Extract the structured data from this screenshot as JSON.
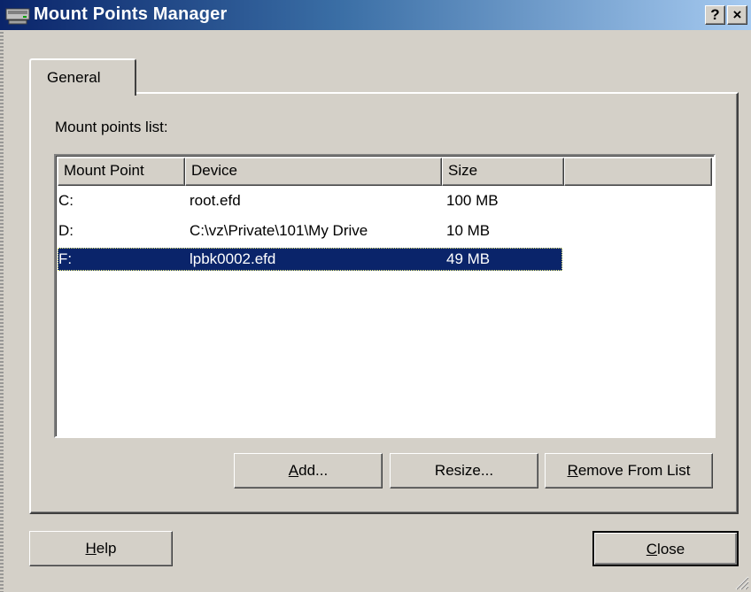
{
  "window": {
    "title": "Mount Points Manager",
    "help_caption": "?",
    "close_caption": "×",
    "icon": "drive-icon"
  },
  "tabs": [
    {
      "label": "General",
      "active": true
    }
  ],
  "panel": {
    "list_caption": "Mount points list:",
    "columns": [
      "Mount Point",
      "Device",
      "Size",
      ""
    ],
    "rows": [
      {
        "mount_point": "C:",
        "device": "root.efd",
        "size": "100 MB",
        "selected": false
      },
      {
        "mount_point": "D:",
        "device": "C:\\vz\\Private\\101\\My Drive",
        "size": "10 MB",
        "selected": false
      },
      {
        "mount_point": "F:",
        "device": "lpbk0002.efd",
        "size": "49 MB",
        "selected": true
      }
    ],
    "buttons": {
      "add": {
        "mnemonic": "A",
        "rest": "dd..."
      },
      "resize": "Resize...",
      "remove": {
        "mnemonic": "R",
        "rest": "emove From List"
      }
    }
  },
  "footer": {
    "help": {
      "mnemonic": "H",
      "rest": "elp"
    },
    "close": {
      "mnemonic": "C",
      "rest": "lose"
    }
  },
  "colors": {
    "title_start": "#0a246a",
    "title_end": "#a6caf0",
    "selection": "#0a246a",
    "face": "#d4d0c8"
  }
}
